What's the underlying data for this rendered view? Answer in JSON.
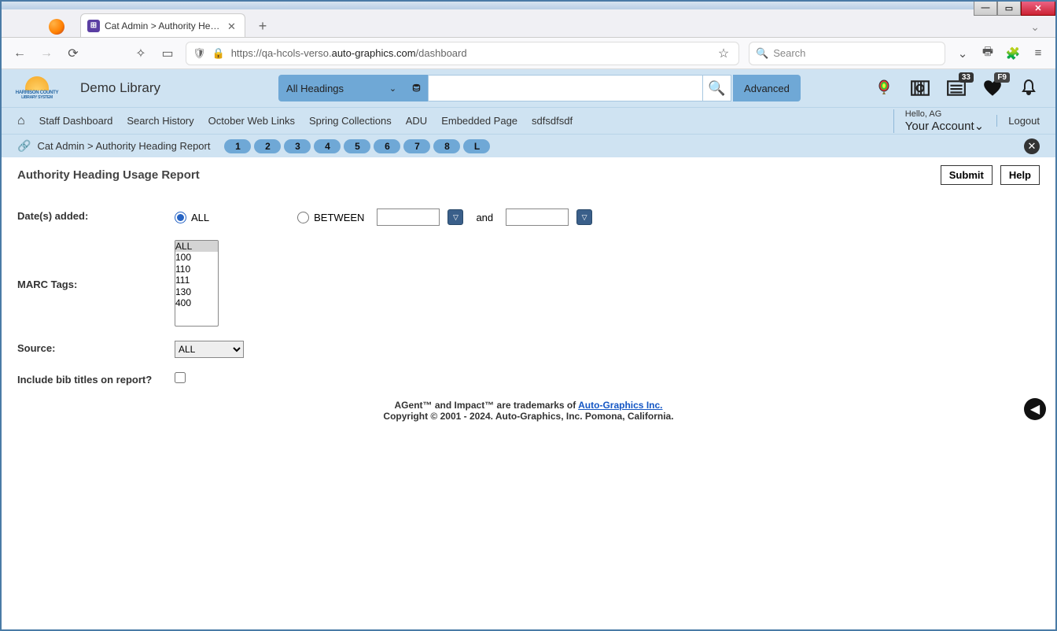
{
  "browser": {
    "tab_title": "Cat Admin > Authority Headin...",
    "url_prefix": "https://qa-hcols-verso.",
    "url_domain": "auto-graphics.com",
    "url_path": "/dashboard",
    "search_placeholder": "Search"
  },
  "header": {
    "site_name": "Demo Library",
    "dropdown_label": "All Headings",
    "advanced_label": "Advanced",
    "badge_notifications": "33",
    "badge_fkey": "F9"
  },
  "nav": {
    "items": [
      "Staff Dashboard",
      "Search History",
      "October Web Links",
      "Spring Collections",
      "ADU",
      "Embedded Page",
      "sdfsdfsdf"
    ],
    "hello_text": "Hello, AG",
    "account_text": "Your Account",
    "logout_text": "Logout"
  },
  "breadcrumb": {
    "path": "Cat Admin  >  Authority Heading Report",
    "pills": [
      "1",
      "2",
      "3",
      "4",
      "5",
      "6",
      "7",
      "8",
      "L"
    ]
  },
  "page": {
    "title": "Authority Heading Usage Report",
    "submit_label": "Submit",
    "help_label": "Help"
  },
  "form": {
    "dates_label": "Date(s) added:",
    "all_label": "ALL",
    "between_label": "BETWEEN",
    "and_label": "and",
    "marc_label": "MARC Tags:",
    "marc_options": [
      "ALL",
      "100",
      "110",
      "111",
      "130",
      "400"
    ],
    "source_label": "Source:",
    "source_value": "ALL",
    "include_label": "Include bib titles on report?"
  },
  "footer": {
    "line1_prefix": "AGent™ and Impact™ are trademarks of ",
    "line1_link": "Auto-Graphics Inc.",
    "line2": "Copyright © 2001 - 2024. Auto-Graphics, Inc. Pomona, California."
  }
}
